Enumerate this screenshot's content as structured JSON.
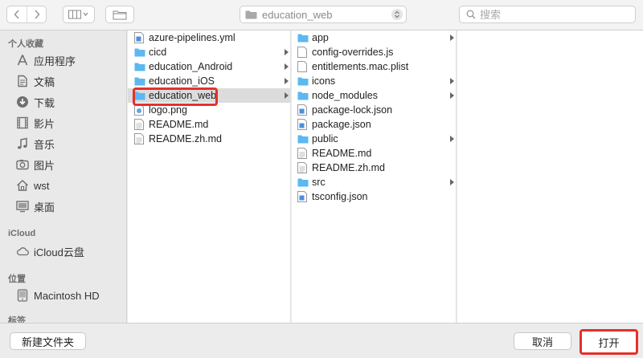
{
  "toolbar": {
    "path_label": "education_web",
    "search_placeholder": "搜索"
  },
  "sidebar": {
    "sections": [
      {
        "title": "个人收藏",
        "items": [
          {
            "label": "应用程序",
            "icon": "applications-icon"
          },
          {
            "label": "文稿",
            "icon": "documents-icon"
          },
          {
            "label": "下载",
            "icon": "downloads-icon"
          },
          {
            "label": "影片",
            "icon": "movies-icon"
          },
          {
            "label": "音乐",
            "icon": "music-icon"
          },
          {
            "label": "图片",
            "icon": "pictures-icon"
          },
          {
            "label": "wst",
            "icon": "home-icon"
          },
          {
            "label": "桌面",
            "icon": "desktop-icon"
          }
        ]
      },
      {
        "title": "iCloud",
        "items": [
          {
            "label": "iCloud云盘",
            "icon": "cloud-icon"
          }
        ]
      },
      {
        "title": "位置",
        "items": [
          {
            "label": "Macintosh HD",
            "icon": "harddrive-icon"
          }
        ]
      },
      {
        "title": "标签",
        "items": []
      }
    ]
  },
  "column1": {
    "items": [
      {
        "label": "azure-pipelines.yml",
        "type": "file-code"
      },
      {
        "label": "cicd",
        "type": "folder"
      },
      {
        "label": "education_Android",
        "type": "folder"
      },
      {
        "label": "education_iOS",
        "type": "folder"
      },
      {
        "label": "education_web",
        "type": "folder",
        "selected": true
      },
      {
        "label": "logo.png",
        "type": "file-image"
      },
      {
        "label": "README.md",
        "type": "file-text"
      },
      {
        "label": "README.zh.md",
        "type": "file-text"
      }
    ]
  },
  "column2": {
    "items": [
      {
        "label": "app",
        "type": "folder"
      },
      {
        "label": "config-overrides.js",
        "type": "file-blank"
      },
      {
        "label": "entitlements.mac.plist",
        "type": "file-blank"
      },
      {
        "label": "icons",
        "type": "folder"
      },
      {
        "label": "node_modules",
        "type": "folder"
      },
      {
        "label": "package-lock.json",
        "type": "file-code"
      },
      {
        "label": "package.json",
        "type": "file-code"
      },
      {
        "label": "public",
        "type": "folder"
      },
      {
        "label": "README.md",
        "type": "file-text"
      },
      {
        "label": "README.zh.md",
        "type": "file-text"
      },
      {
        "label": "src",
        "type": "folder"
      },
      {
        "label": "tsconfig.json",
        "type": "file-code"
      }
    ]
  },
  "footer": {
    "new_folder_label": "新建文件夹",
    "cancel_label": "取消",
    "open_label": "打开"
  },
  "colors": {
    "folder": "#5cb8f0",
    "highlight": "#e4312b",
    "selected_row": "#dcdcdc"
  }
}
